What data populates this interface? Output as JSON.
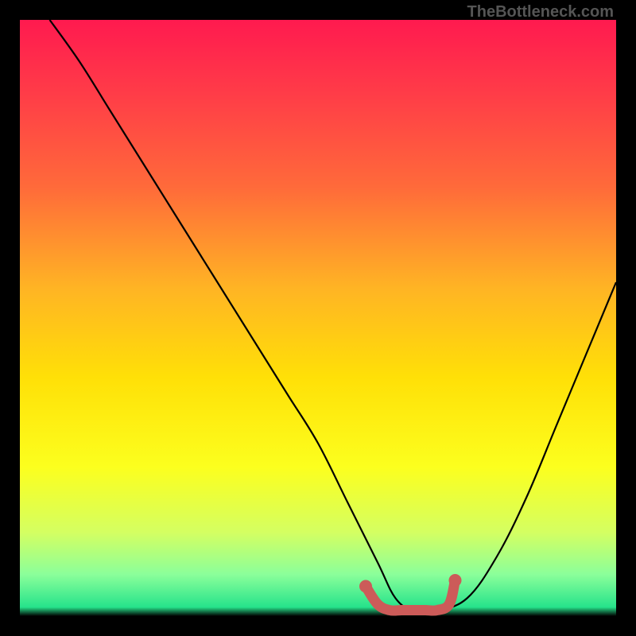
{
  "watermark": "TheBottleneck.com",
  "chart_data": {
    "type": "line",
    "title": "",
    "xlabel": "",
    "ylabel": "",
    "xlim": [
      0,
      100
    ],
    "ylim": [
      0,
      100
    ],
    "series": [
      {
        "name": "bottleneck-curve",
        "x": [
          5,
          10,
          15,
          20,
          25,
          30,
          35,
          40,
          45,
          50,
          55,
          60,
          63,
          66,
          70,
          75,
          80,
          85,
          90,
          95,
          100
        ],
        "y": [
          100,
          93,
          85,
          77,
          69,
          61,
          53,
          45,
          37,
          29,
          19,
          9,
          3,
          1,
          1,
          3,
          10,
          20,
          32,
          44,
          56
        ],
        "color": "#000000"
      },
      {
        "name": "optimal-marker",
        "x": [
          58,
          60,
          62,
          64,
          66,
          68,
          70,
          72,
          73
        ],
        "y": [
          5,
          2,
          1,
          1,
          1,
          1,
          1,
          2,
          6
        ],
        "color": "#cc5b59"
      }
    ],
    "gradient_stops": [
      {
        "offset": 0.0,
        "color": "#ff1a4f"
      },
      {
        "offset": 0.12,
        "color": "#ff3b48"
      },
      {
        "offset": 0.28,
        "color": "#ff6a3a"
      },
      {
        "offset": 0.45,
        "color": "#ffb424"
      },
      {
        "offset": 0.6,
        "color": "#ffe007"
      },
      {
        "offset": 0.75,
        "color": "#fcff1e"
      },
      {
        "offset": 0.86,
        "color": "#d4ff62"
      },
      {
        "offset": 0.93,
        "color": "#8bff9a"
      },
      {
        "offset": 0.985,
        "color": "#26e38b"
      },
      {
        "offset": 1.0,
        "color": "#000000"
      }
    ]
  }
}
